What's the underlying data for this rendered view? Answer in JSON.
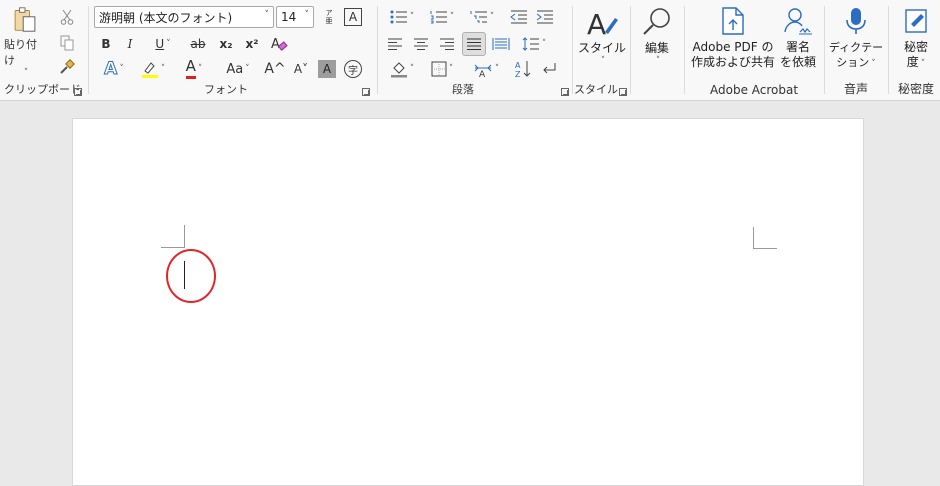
{
  "clipboard": {
    "paste_label": "貼り付け",
    "group_label": "クリップボード"
  },
  "font": {
    "font_name": "游明朝 (本文のフォント)",
    "font_size": "14",
    "bold": "B",
    "italic": "I",
    "underline": "U",
    "strikethrough": "ab",
    "subscript": "x₂",
    "superscript": "x²",
    "grow": "A^",
    "shrink": "A˅",
    "change_case": "Aa",
    "char_shading": "A",
    "enclose": "字",
    "phonetic": "ア亜",
    "char_border": "A",
    "text_effects": "A",
    "font_color": "A",
    "group_label": "フォント"
  },
  "paragraph": {
    "group_label": "段落"
  },
  "styles": {
    "label": "スタイル",
    "group_label": "スタイル"
  },
  "editing": {
    "label": "編集"
  },
  "acrobat": {
    "pdf_label_1": "Adobe PDF の",
    "pdf_label_2": "作成および共有",
    "sign_label_1": "署名",
    "sign_label_2": "を依頼",
    "group_label": "Adobe Acrobat"
  },
  "voice": {
    "dictate_label_1": "ディクテー",
    "dictate_label_2": "ション",
    "group_label": "音声"
  },
  "sensitivity": {
    "label_1": "秘密",
    "label_2": "度",
    "group_label": "秘密度"
  },
  "colors": {
    "accent_blue": "#2b6cc4",
    "highlight_yellow": "#ffff00",
    "font_red": "#e02020",
    "annotation_red": "#e0262a"
  }
}
